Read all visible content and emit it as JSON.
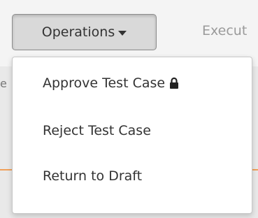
{
  "toolbar": {
    "operations_label": "Operations",
    "next_tab_label": "Execut"
  },
  "underlay": {
    "partial_text": "e"
  },
  "menu": {
    "items": [
      {
        "label": "Approve Test Case",
        "icon": "lock-icon"
      },
      {
        "label": "Reject Test Case"
      },
      {
        "label": "Return to Draft"
      }
    ]
  },
  "colors": {
    "accent_line": "#f0a05a",
    "button_bg": "#d9d9d9",
    "menu_bg": "#ffffff"
  }
}
